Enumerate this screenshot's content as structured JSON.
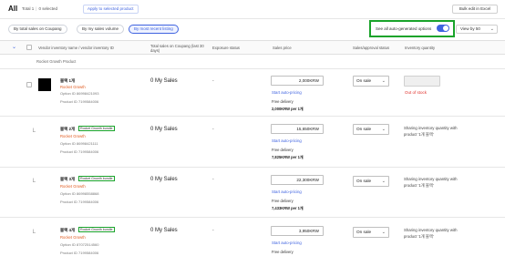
{
  "header": {
    "title": "All",
    "total": "Total 1",
    "selected": "0 selected",
    "apply_label": "Apply to selected product",
    "excel_label": "Bulk edit in Excel"
  },
  "filters": {
    "buttons": [
      "By total sales on Coupang",
      "By my sales volume",
      "By most recent listing"
    ],
    "active_index": 2,
    "auto_label": "See all auto-generated options",
    "auto_enabled": true,
    "viewby_label": "View by 50"
  },
  "columns": {
    "vendor": "Vendor inventory name / vendor inventory ID",
    "total_sales": "Total sales on Coupang (last 30 days)",
    "exposure": "Exposure status",
    "sales_price": "Sales price",
    "sales_approval": "Sales/approval status",
    "inventory": "Inventory quantity"
  },
  "group_label": "Rocket Growth Product",
  "rows": [
    {
      "name": "블랙 1개",
      "tag": "",
      "type": "Rocket Growth",
      "option_id": "Option ID 86998421093",
      "product_id": "Product ID 7199584006",
      "sales": "0 My Sales",
      "exposure": "-",
      "price": "2,000KRW",
      "auto_link": "Start auto-pricing",
      "delivery": "Free delivery",
      "unit_price": "2,000KRW per 1개",
      "status": "On sale",
      "inventory_note": "Out of stock"
    },
    {
      "name": "블랙 2개",
      "tag": "Rocket Growth bundle",
      "type": "Rocket Growth",
      "option_id": "Option ID 86998421111",
      "product_id": "Product ID 7199584006",
      "sales": "0 My Sales",
      "exposure": "-",
      "price": "15,650KRW",
      "auto_link": "Start auto-pricing",
      "delivery": "Free delivery",
      "unit_price": "7,825KRW per 1개",
      "status": "On sale",
      "inventory_note": "Sharing inventory quantity with product '1개 블랙'"
    },
    {
      "name": "블랙 3개",
      "tag": "Rocket Growth bundle",
      "type": "Rocket Growth",
      "option_id": "Option ID 86998558868",
      "product_id": "Product ID 7199584006",
      "sales": "0 My Sales",
      "exposure": "-",
      "price": "22,300KRW",
      "auto_link": "Start auto-pricing",
      "delivery": "Free delivery",
      "unit_price": "7,433KRW per 1개",
      "status": "On sale",
      "inventory_note": "Sharing inventory quantity with product '1개 블랙'"
    },
    {
      "name": "블랙 4개",
      "tag": "Rocket Growth bundle",
      "type": "Rocket Growth",
      "option_id": "Option ID 87072514560",
      "product_id": "Product ID 7199584006",
      "sales": "0 My Sales",
      "exposure": "-",
      "price": "3,950KRW",
      "auto_link": "Start auto-pricing",
      "delivery": "Free delivery",
      "unit_price": "",
      "status": "On sale",
      "inventory_note": "Sharing inventory quantity with product '1개 블랙'"
    }
  ],
  "colors": {
    "accent": "#3f63e0",
    "highlight": "#19a32a",
    "rocket": "#e05a1f",
    "error": "#e0332e"
  }
}
